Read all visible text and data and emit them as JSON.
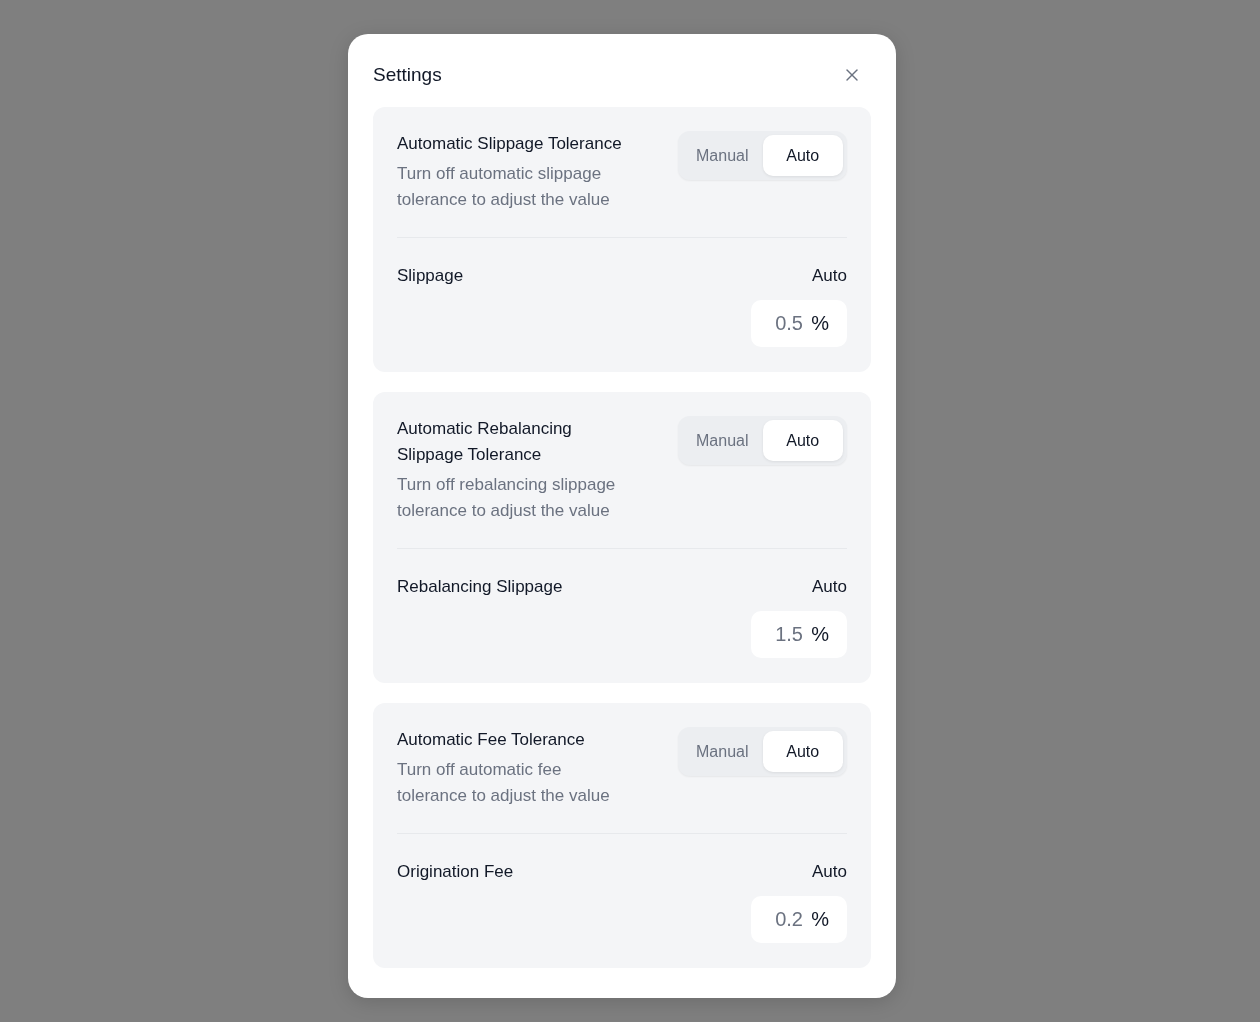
{
  "dialog": {
    "title": "Settings"
  },
  "sections": [
    {
      "title": "Automatic Slippage Tolerance",
      "description": "Turn off automatic slippage tolerance to adjust the value",
      "mode_toggle": [
        {
          "label": "Manual",
          "selected": false
        },
        {
          "label": "Auto",
          "selected": true
        }
      ],
      "setting": {
        "label": "Slippage",
        "mode": "Auto",
        "value": "0.5",
        "unit": "%"
      }
    },
    {
      "title": "Automatic Rebalancing Slippage Tolerance",
      "description": "Turn off rebalancing slippage tolerance to adjust the value",
      "mode_toggle": [
        {
          "label": "Manual",
          "selected": false
        },
        {
          "label": "Auto",
          "selected": true
        }
      ],
      "setting": {
        "label": "Rebalancing Slippage",
        "mode": "Auto",
        "value": "1.5",
        "unit": "%"
      }
    },
    {
      "title": "Automatic Fee Tolerance",
      "description": "Turn off automatic fee tolerance to adjust the value",
      "mode_toggle": [
        {
          "label": "Manual",
          "selected": false
        },
        {
          "label": "Auto",
          "selected": true
        }
      ],
      "setting": {
        "label": "Origination Fee",
        "mode": "Auto",
        "value": "0.2",
        "unit": "%"
      }
    }
  ]
}
